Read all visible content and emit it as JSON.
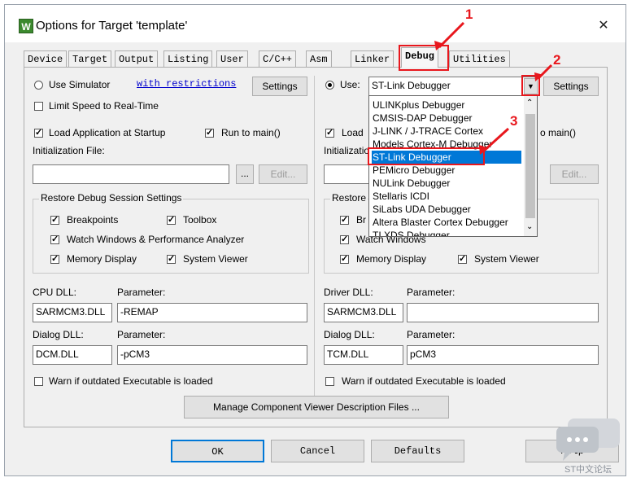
{
  "window": {
    "title": "Options for Target 'template'",
    "app_icon": "W",
    "close_glyph": "✕"
  },
  "tabs": [
    {
      "label": "Device",
      "active": false
    },
    {
      "label": "Target",
      "active": false
    },
    {
      "label": "Output",
      "active": false
    },
    {
      "label": "Listing",
      "active": false
    },
    {
      "label": "User",
      "active": false
    },
    {
      "label": "C/C++",
      "active": false
    },
    {
      "label": "Asm",
      "active": false
    },
    {
      "label": "Linker",
      "active": false
    },
    {
      "label": "Debug",
      "active": true
    },
    {
      "label": "Utilities",
      "active": false
    }
  ],
  "left": {
    "use_simulator": "Use Simulator",
    "restrictions_link": "with restrictions",
    "settings": "Settings",
    "limit_speed": "Limit Speed to Real-Time",
    "load_app": "Load Application at Startup",
    "run_to_main": "Run to main()",
    "init_file_label": "Initialization File:",
    "init_file_value": "",
    "browse": "...",
    "edit": "Edit...",
    "restore_group": "Restore Debug Session Settings",
    "breakpoints": "Breakpoints",
    "toolbox": "Toolbox",
    "watch_windows": "Watch Windows & Performance Analyzer",
    "memory_display": "Memory Display",
    "system_viewer": "System Viewer",
    "cpu_dll_label": "CPU DLL:",
    "cpu_param_label": "Parameter:",
    "cpu_dll": "SARMCM3.DLL",
    "cpu_param": "-REMAP",
    "dialog_dll_label": "Dialog DLL:",
    "dialog_param_label": "Parameter:",
    "dialog_dll": "DCM.DLL",
    "dialog_param": "-pCM3",
    "warn_outdated": "Warn if outdated Executable is loaded"
  },
  "right": {
    "use_label": "Use:",
    "debugger_selected": "ST-Link Debugger",
    "settings": "Settings",
    "load_partial": "Load",
    "run_partial": "o main()",
    "init_partial": "Initializatio",
    "edit": "Edit...",
    "restore_partial": "Restore",
    "br_partial": "Br",
    "watch_partial": "Watch Windows",
    "memory_display": "Memory Display",
    "system_viewer": "System Viewer",
    "driver_dll_label": "Driver DLL:",
    "driver_param_label": "Parameter:",
    "driver_dll": "SARMCM3.DLL",
    "driver_param": "",
    "dialog_dll_label": "Dialog DLL:",
    "dialog_param_label": "Parameter:",
    "dialog_dll": "TCM.DLL",
    "dialog_param": "pCM3",
    "warn_outdated": "Warn if outdated Executable is loaded"
  },
  "dropdown": {
    "items": [
      "ULINKplus Debugger",
      "CMSIS-DAP Debugger",
      "J-LINK / J-TRACE Cortex",
      "Models Cortex-M Debugger",
      "ST-Link Debugger",
      "PEMicro Debugger",
      "NULink Debugger",
      "Stellaris ICDI",
      "SiLabs UDA Debugger",
      "Altera Blaster Cortex Debugger",
      "TI XDS Debugger"
    ],
    "selected_index": 4
  },
  "manage_button": "Manage Component Viewer Description Files ...",
  "footer": {
    "ok": "OK",
    "cancel": "Cancel",
    "defaults": "Defaults",
    "help": "Help"
  },
  "annotations": {
    "n1": "1",
    "n2": "2",
    "n3": "3",
    "color": "#e8171d"
  },
  "watermark": {
    "text": "ST中文论坛"
  }
}
